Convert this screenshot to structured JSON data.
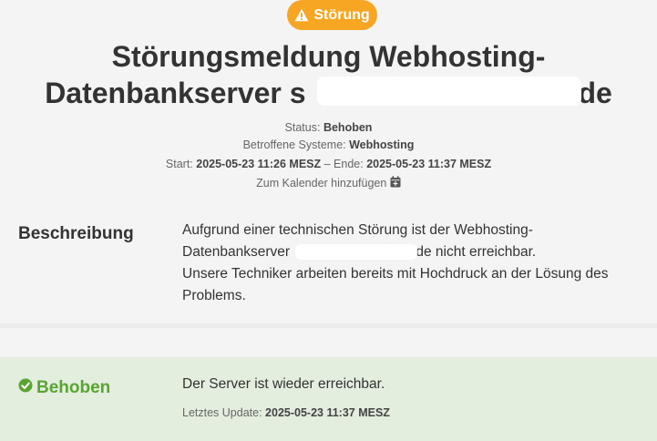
{
  "badge": {
    "label": "Störung",
    "icon": "warning-triangle-icon",
    "color": "#f6a623"
  },
  "header": {
    "title_line1": "Störungsmeldung Webhosting-",
    "title_line2_prefix": "Datenbankserver s",
    "title_line2_suffix": ".de"
  },
  "meta": {
    "status_label": "Status:",
    "status_value": "Behoben",
    "systems_label": "Betroffene Systeme:",
    "systems_value": "Webhosting",
    "start_label": "Start:",
    "start_value": "2025-05-23 11:26 MESZ",
    "end_label": "– Ende:",
    "end_value": "2025-05-23 11:37 MESZ",
    "calendar_label": "Zum Kalender hinzufügen",
    "calendar_icon": "calendar-plus-icon"
  },
  "description": {
    "title": "Beschreibung",
    "line1": "Aufgrund einer technischen Störung ist der Webhosting-",
    "line2_prefix": "Datenbankserver",
    "line2_suffix": ".de nicht erreichbar.",
    "line3": "Unsere Techniker arbeiten bereits mit Hochdruck an der Lösung des",
    "line4": "Problems."
  },
  "update": {
    "title": "Behoben",
    "icon": "check-circle-icon",
    "color": "#5aa431",
    "message": "Der Server ist wieder erreichbar.",
    "last_update_label": "Letztes Update:",
    "last_update_value": "2025-05-23 11:37 MESZ"
  }
}
